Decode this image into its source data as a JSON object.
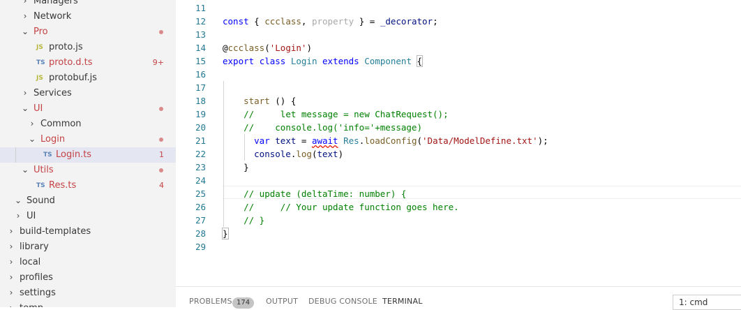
{
  "explorer": {
    "items": [
      {
        "label": "Managers",
        "type": "folder",
        "expanded": false
      },
      {
        "label": "Network",
        "type": "folder",
        "expanded": false
      },
      {
        "label": "Pro",
        "type": "folder",
        "expanded": true,
        "error": true,
        "modified": true
      },
      {
        "label": "proto.js",
        "type": "file",
        "lang": "JS"
      },
      {
        "label": "proto.d.ts",
        "type": "file",
        "lang": "TS",
        "error": true,
        "badge": "9+"
      },
      {
        "label": "protobuf.js",
        "type": "file",
        "lang": "JS"
      },
      {
        "label": "Services",
        "type": "folder",
        "expanded": false
      },
      {
        "label": "UI",
        "type": "folder",
        "expanded": true,
        "error": true,
        "modified": true
      },
      {
        "label": "Common",
        "type": "folder",
        "expanded": false
      },
      {
        "label": "Login",
        "type": "folder",
        "expanded": true,
        "error": true,
        "modified": true
      },
      {
        "label": "Login.ts",
        "type": "file",
        "lang": "TS",
        "error": true,
        "badge": "1",
        "selected": true
      },
      {
        "label": "Utils",
        "type": "folder",
        "expanded": true,
        "error": true,
        "modified": true
      },
      {
        "label": "Res.ts",
        "type": "file",
        "lang": "TS",
        "error": true,
        "badge": "4"
      },
      {
        "label": "Sound",
        "type": "folder",
        "expanded": true
      },
      {
        "label": "UI",
        "type": "folder",
        "expanded": false
      },
      {
        "label": "build-templates",
        "type": "folder",
        "expanded": false
      },
      {
        "label": "library",
        "type": "folder",
        "expanded": false
      },
      {
        "label": "local",
        "type": "folder",
        "expanded": false
      },
      {
        "label": "profiles",
        "type": "folder",
        "expanded": false
      },
      {
        "label": "settings",
        "type": "folder",
        "expanded": false
      },
      {
        "label": "temp",
        "type": "folder",
        "expanded": false
      }
    ]
  },
  "editor": {
    "lines": [
      {
        "num": "11",
        "tokens": []
      },
      {
        "num": "12",
        "tokens": [
          {
            "t": "const",
            "c": "kw"
          },
          {
            "t": " { "
          },
          {
            "t": "ccclass",
            "c": "fn"
          },
          {
            "t": ", "
          },
          {
            "t": "property",
            "c": "fd"
          },
          {
            "t": " } = "
          },
          {
            "t": "_decorator",
            "c": "vr"
          },
          {
            "t": ";"
          }
        ]
      },
      {
        "num": "13",
        "tokens": []
      },
      {
        "num": "14",
        "tokens": [
          {
            "t": "@"
          },
          {
            "t": "ccclass",
            "c": "fn"
          },
          {
            "t": "("
          },
          {
            "t": "'Login'",
            "c": "st"
          },
          {
            "t": ")"
          }
        ]
      },
      {
        "num": "15",
        "tokens": [
          {
            "t": "export",
            "c": "kw"
          },
          {
            "t": " "
          },
          {
            "t": "class",
            "c": "kw"
          },
          {
            "t": " "
          },
          {
            "t": "Login",
            "c": "ty"
          },
          {
            "t": " "
          },
          {
            "t": "extends",
            "c": "kw"
          },
          {
            "t": " "
          },
          {
            "t": "Component",
            "c": "ty"
          },
          {
            "t": " "
          },
          {
            "t": "{",
            "c": "bm"
          }
        ]
      },
      {
        "num": "16",
        "tokens": []
      },
      {
        "num": "17",
        "tokens": []
      },
      {
        "num": "18",
        "tokens": [
          {
            "t": "    "
          },
          {
            "t": "start",
            "c": "fn"
          },
          {
            "t": " () {"
          }
        ]
      },
      {
        "num": "19",
        "tokens": [
          {
            "t": "    "
          },
          {
            "t": "//     let message = new ChatRequest();",
            "c": "cm"
          }
        ]
      },
      {
        "num": "20",
        "tokens": [
          {
            "t": "    "
          },
          {
            "t": "//    console.log('info='+message)",
            "c": "cm"
          }
        ]
      },
      {
        "num": "21",
        "tokens": [
          {
            "t": "      "
          },
          {
            "t": "var",
            "c": "kw"
          },
          {
            "t": " "
          },
          {
            "t": "text",
            "c": "vr"
          },
          {
            "t": " = "
          },
          {
            "t": "await",
            "c": "kw sq"
          },
          {
            "t": " "
          },
          {
            "t": "Res",
            "c": "ty"
          },
          {
            "t": "."
          },
          {
            "t": "loadConfig",
            "c": "fn"
          },
          {
            "t": "("
          },
          {
            "t": "'Data/ModelDefine.txt'",
            "c": "st"
          },
          {
            "t": ");"
          }
        ]
      },
      {
        "num": "22",
        "tokens": [
          {
            "t": "      "
          },
          {
            "t": "console",
            "c": "vr"
          },
          {
            "t": "."
          },
          {
            "t": "log",
            "c": "fn"
          },
          {
            "t": "("
          },
          {
            "t": "text",
            "c": "vr"
          },
          {
            "t": ")"
          }
        ]
      },
      {
        "num": "23",
        "tokens": [
          {
            "t": "    }"
          }
        ]
      },
      {
        "num": "24",
        "tokens": []
      },
      {
        "num": "25",
        "tokens": [
          {
            "t": "    "
          },
          {
            "t": "// update (deltaTime: number) {",
            "c": "cm"
          }
        ]
      },
      {
        "num": "26",
        "tokens": [
          {
            "t": "    "
          },
          {
            "t": "//     // Your update function goes here.",
            "c": "cm"
          }
        ]
      },
      {
        "num": "27",
        "tokens": [
          {
            "t": "    "
          },
          {
            "t": "// }",
            "c": "cm"
          }
        ]
      },
      {
        "num": "28",
        "tokens": [
          {
            "t": "}",
            "c": "bm"
          }
        ]
      },
      {
        "num": "29",
        "tokens": []
      }
    ]
  },
  "panel": {
    "tabs": [
      {
        "label": "PROBLEMS",
        "count": "174"
      },
      {
        "label": "OUTPUT"
      },
      {
        "label": "DEBUG CONSOLE"
      },
      {
        "label": "TERMINAL",
        "active": true
      }
    ],
    "terminal_select": "1: cmd"
  },
  "icons": {
    "chevron_right": "›",
    "chevron_down": "⌄"
  },
  "colors": {
    "error": "#c54244",
    "selection": "#e4e6f1",
    "keyword": "#0000ff",
    "string": "#a31515",
    "comment": "#008000"
  }
}
